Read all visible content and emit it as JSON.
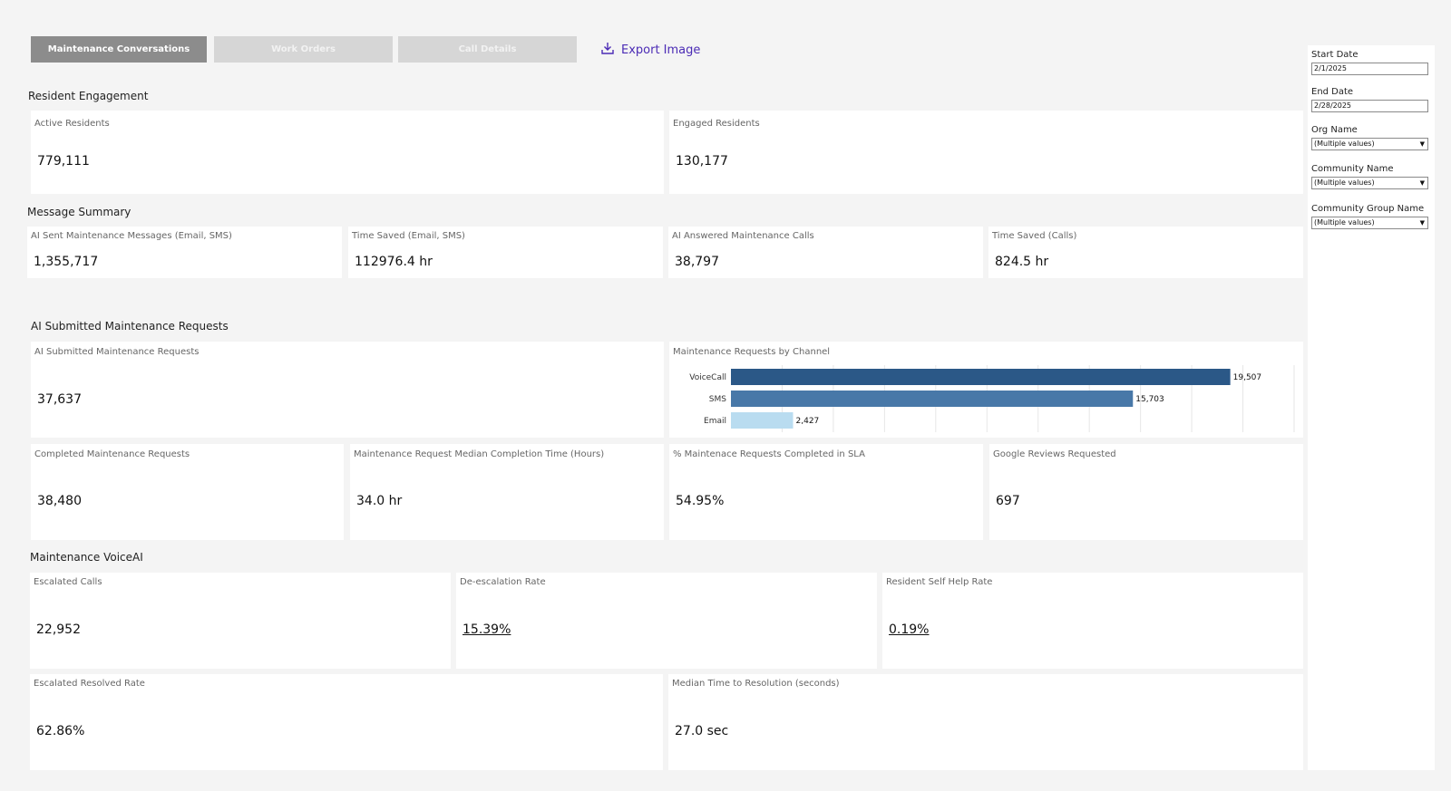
{
  "tabs": [
    {
      "label": "Maintenance Conversations",
      "active": true
    },
    {
      "label": "Work Orders",
      "active": false
    },
    {
      "label": "Call Details",
      "active": false
    }
  ],
  "export_label": "Export Image",
  "sections": {
    "resident_engagement": "Resident Engagement",
    "message_summary": "Message Summary",
    "ai_submitted": "AI Submitted Maintenance Requests",
    "voiceai": "Maintenance VoiceAI"
  },
  "kpis": {
    "active_residents": {
      "label": "Active Residents",
      "value": "779,111"
    },
    "engaged_residents": {
      "label": "Engaged Residents",
      "value": "130,177"
    },
    "ai_sent_messages": {
      "label": "AI Sent Maintenance Messages (Email, SMS)",
      "value": "1,355,717"
    },
    "time_saved_email_sms": {
      "label": "Time Saved (Email, SMS)",
      "value": "112976.4 hr"
    },
    "ai_answered_calls": {
      "label": "AI Answered Maintenance Calls",
      "value": "38,797"
    },
    "time_saved_calls": {
      "label": "Time Saved (Calls)",
      "value": "824.5 hr"
    },
    "ai_submitted_requests": {
      "label": "AI  Submitted Maintenance Requests",
      "value": "37,637"
    },
    "completed_requests": {
      "label": "Completed  Maintenance Requests",
      "value": "38,480"
    },
    "median_completion": {
      "label": "Maintenance Request Median Completion Time (Hours)",
      "value": "34.0 hr"
    },
    "pct_in_sla": {
      "label": "% Maintenace Requests Completed in SLA",
      "value": "54.95%"
    },
    "google_reviews": {
      "label": "Google Reviews Requested",
      "value": "697"
    },
    "escalated_calls": {
      "label": "Escalated Calls",
      "value": "22,952"
    },
    "deescalation_rate": {
      "label": "De-escalation Rate",
      "value": "15.39%"
    },
    "self_help_rate": {
      "label": "Resident Self Help Rate",
      "value": "0.19%"
    },
    "escalated_resolved": {
      "label": "Escalated Resolved Rate",
      "value": "62.86%"
    },
    "median_resolution": {
      "label": "Median Time to Resolution (seconds)",
      "value": "27.0 sec"
    }
  },
  "channel_chart_title": "Maintenance Requests by Channel",
  "chart_data": {
    "type": "bar",
    "orientation": "horizontal",
    "title": "Maintenance Requests by Channel",
    "categories": [
      "VoiceCall",
      "SMS",
      "Email"
    ],
    "values": [
      19507,
      15703,
      2427
    ],
    "value_labels": [
      "19,507",
      "15,703",
      "2,427"
    ],
    "colors": [
      "#2b5887",
      "#4878a8",
      "#b9dcf0"
    ],
    "xlim": [
      0,
      22000
    ],
    "grid": true
  },
  "filters": {
    "start_date": {
      "label": "Start Date",
      "value": "2/1/2025"
    },
    "end_date": {
      "label": "End Date",
      "value": "2/28/2025"
    },
    "org_name": {
      "label": "Org Name",
      "value": "(Multiple values)"
    },
    "community_name": {
      "label": "Community Name",
      "value": "(Multiple values)"
    },
    "community_group": {
      "label": "Community Group Name",
      "value": "(Multiple values)"
    }
  }
}
